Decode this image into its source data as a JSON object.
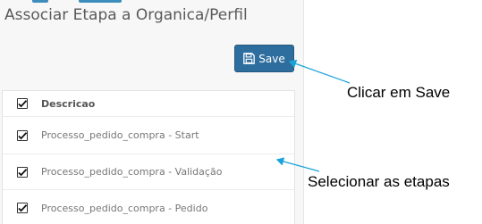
{
  "page": {
    "title": "Associar Etapa a Organica/Perfil"
  },
  "toolbar": {
    "save_label": "Save",
    "save_icon": "floppy-disk-icon",
    "accent_color": "#2e6e9e"
  },
  "grid": {
    "select_all_checked": true,
    "column_header": "Descricao",
    "rows": [
      {
        "checked": true,
        "label": "Processo_pedido_compra - Start"
      },
      {
        "checked": true,
        "label": "Processo_pedido_compra - Validação"
      },
      {
        "checked": true,
        "label": "Processo_pedido_compra - Pedido"
      }
    ]
  },
  "annotations": {
    "save_hint": "Clicar em Save",
    "select_hint": "Selecionar as etapas",
    "arrow_color": "#1aa3d9"
  }
}
